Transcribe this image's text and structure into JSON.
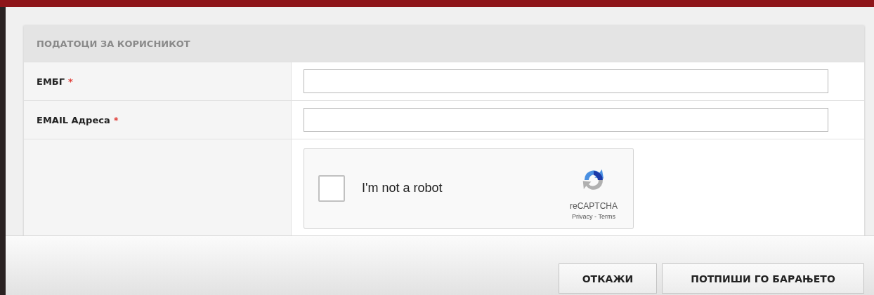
{
  "section": {
    "title": "ПОДАТОЦИ ЗА КОРИСНИКОТ"
  },
  "fields": [
    {
      "label": "ЕМБГ",
      "required_mark": "*"
    },
    {
      "label": "EMAIL Адреса",
      "required_mark": "*"
    }
  ],
  "captcha": {
    "label": "I'm not a robot",
    "checked": false,
    "brand": "reCAPTCHA",
    "links": "Privacy - Terms"
  },
  "buttons": [
    {
      "label": "ОТКАЖИ"
    },
    {
      "label": "ПОТПИШИ ГО БАРАЊЕТО"
    }
  ]
}
